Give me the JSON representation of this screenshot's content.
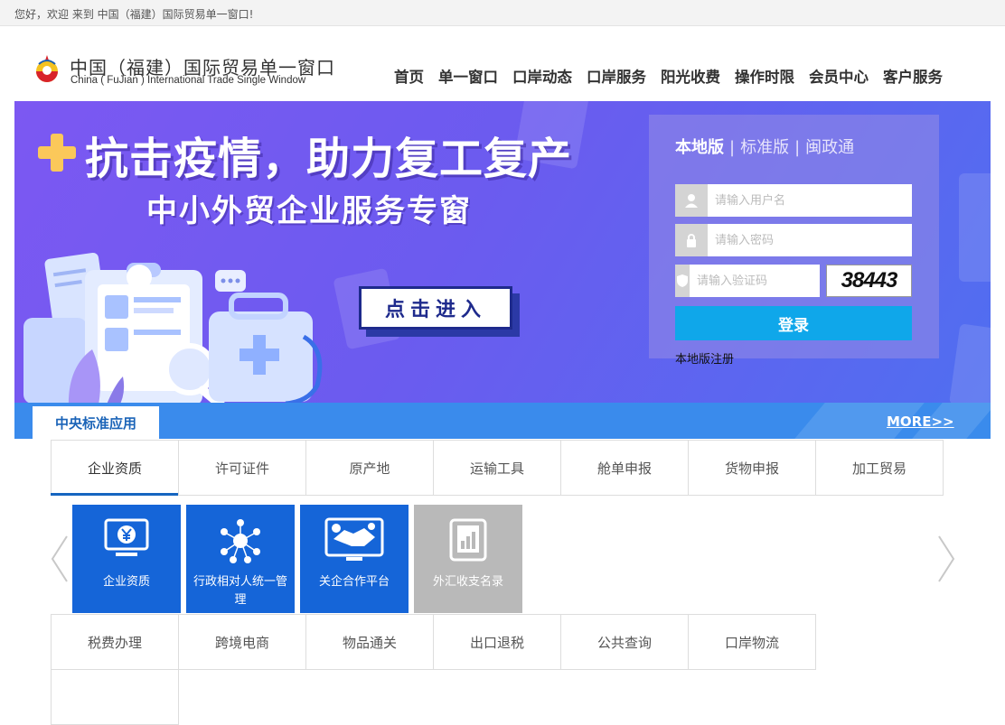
{
  "topbar": {
    "greeting": "您好，欢迎   来到 中国（福建）国际贸易单一窗口!"
  },
  "header": {
    "logo_cn": "中国（福建）国际贸易单一窗口",
    "logo_en": "China (   FuJian   ) International Trade Single  Window",
    "nav": [
      "首页",
      "单一窗口",
      "口岸动态",
      "口岸服务",
      "阳光收费",
      "操作时限",
      "会员中心",
      "客户服务"
    ]
  },
  "banner": {
    "title1": "抗击疫情，助力复工复产",
    "title2": "中小外贸企业服务专窗",
    "enter_label": "点击进入"
  },
  "login": {
    "tabs": [
      "本地版",
      "标准版",
      "闽政通"
    ],
    "tab_sep": "|",
    "username_placeholder": "请输入用户名",
    "password_placeholder": "请输入密码",
    "captcha_placeholder": "请输入验证码",
    "captcha_text": "38443",
    "login_label": "登录",
    "register_label": "本地版注册"
  },
  "section": {
    "tab_label": "中央标准应用",
    "more_label": "MORE>>"
  },
  "categories_row1": [
    "企业资质",
    "许可证件",
    "原产地",
    "运输工具",
    "舱单申报",
    "货物申报",
    "加工贸易"
  ],
  "tiles": [
    {
      "label": "企业资质",
      "icon": "monitor-yen-icon",
      "color": "#1565d8"
    },
    {
      "label": "行政相对人统一管理",
      "icon": "people-network-icon",
      "color": "#1565d8"
    },
    {
      "label": "关企合作平台",
      "icon": "handshake-icon",
      "color": "#1565d8"
    },
    {
      "label": "外汇收支名录",
      "icon": "chart-book-icon",
      "color": "#b9b9b9"
    }
  ],
  "categories_row2": [
    "税费办理",
    "跨境电商",
    "物品通关",
    "出口退税",
    "公共查询",
    "口岸物流"
  ]
}
